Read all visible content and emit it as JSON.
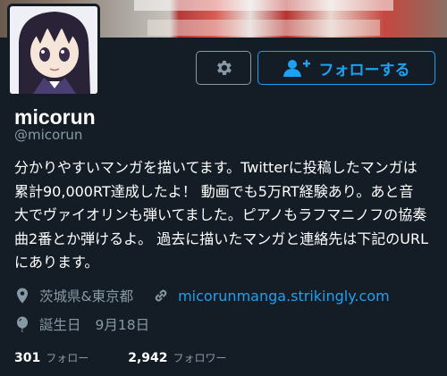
{
  "profile": {
    "display_name": "micorun",
    "handle": "@micorun",
    "bio_lines": [
      "分かりやすいマンガを描いてます。Twitterに投稿したマンガは",
      "累計90,000RT達成したよ！ 動画でも5万RT経験あり。あと音",
      "大でヴァイオリンも弾いてました。ピアノもラフマニノフの協奏",
      "曲2番とか弾けるよ。 過去に描いたマンガと連絡先は下記のURL",
      "にあります。"
    ],
    "location": "茨城県&東京都",
    "website": "micorunmanga.strikingly.com",
    "birthday_label": "誕生日",
    "birthday_value": "9月18日"
  },
  "buttons": {
    "follow_label": "フォローする",
    "settings_icon": "gear-icon",
    "follow_icon": "add-user-icon"
  },
  "stats": {
    "following_count": "301",
    "following_label": "フォロー",
    "followers_count": "2,942",
    "followers_label": "フォロワー"
  },
  "colors": {
    "background": "#141d26",
    "accent": "#1da1f2",
    "muted": "#8899a6"
  }
}
